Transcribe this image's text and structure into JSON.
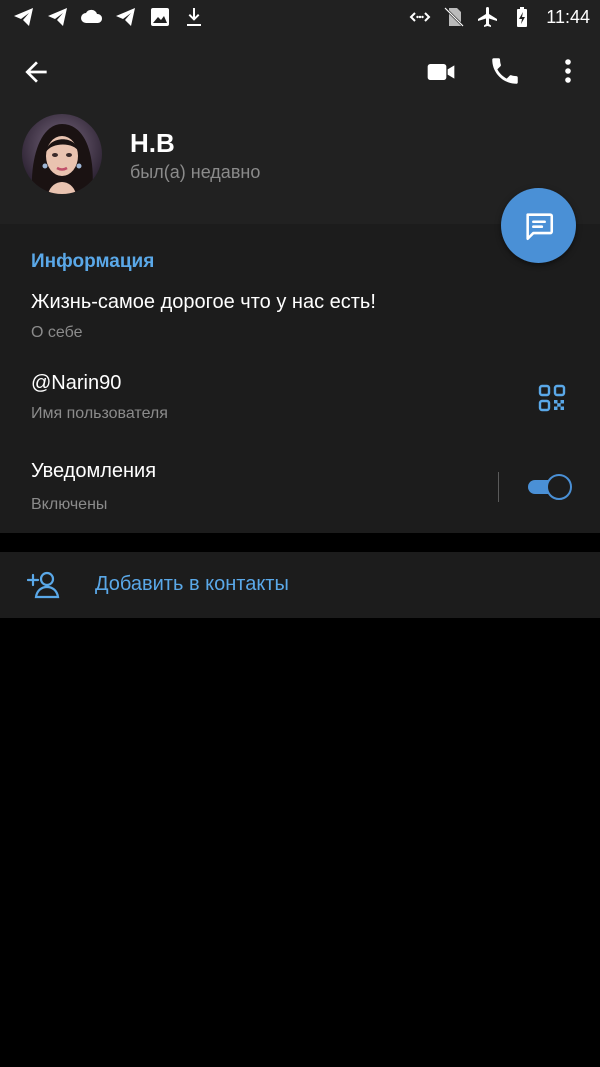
{
  "status_bar": {
    "time": "11:44",
    "left_icons": [
      "telegram-icon",
      "telegram-icon",
      "cloud-icon",
      "telegram-icon",
      "image-icon",
      "download-icon"
    ],
    "right_icons": [
      "code-signal-icon",
      "no-sim-icon",
      "airplane-icon",
      "battery-charging-icon"
    ]
  },
  "header": {
    "name": "Н.В",
    "last_seen": "был(а) недавно",
    "actions": [
      "back-icon",
      "video-call-icon",
      "phone-icon",
      "more-vert-icon"
    ]
  },
  "info": {
    "section_title": "Информация",
    "bio": {
      "value": "Жизнь-самое дорогое что у нас есть!",
      "label": "О себе"
    },
    "username": {
      "value": "@Narin90",
      "label": "Имя пользователя"
    },
    "notifications": {
      "value": "Уведомления",
      "label": "Включены",
      "enabled": true
    }
  },
  "add_contact": {
    "label": "Добавить в контакты"
  },
  "colors": {
    "accent": "#4a90d6",
    "link": "#5aa8e8",
    "header_bg": "#212121",
    "section_bg": "#1c1c1c",
    "secondary_text": "#8b8b8b"
  }
}
